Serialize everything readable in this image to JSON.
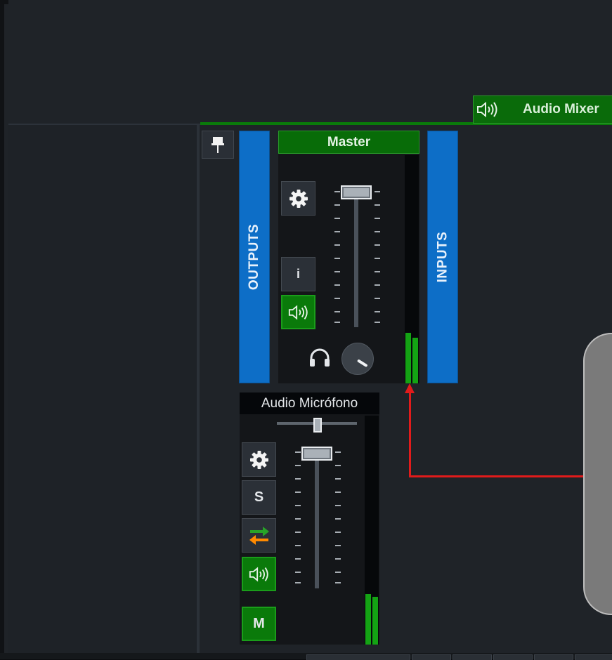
{
  "mixer_tab": {
    "label": "Audio Mixer",
    "icon": "speaker-icon"
  },
  "pin": {
    "icon": "pin-icon"
  },
  "outputs_bar": {
    "label": "OUTPUTS"
  },
  "inputs_bar": {
    "label": "INPUTS"
  },
  "master": {
    "name": "Master",
    "buttons": {
      "settings_icon": "gear-icon",
      "info_label": "i",
      "audio_icon": "speaker-icon"
    },
    "fader_level": 0.98,
    "meter_levels": [
      0.22,
      0.2
    ],
    "headphones_icon": "headphones-icon"
  },
  "mic": {
    "name": "Audio Micrófono",
    "balance": 0.5,
    "fader_level": 0.98,
    "buttons": {
      "settings_icon": "gear-icon",
      "solo_label": "S",
      "route_icon": "swap-arrows-icon",
      "audio_icon": "speaker-icon",
      "mute_label": "M"
    },
    "meter_levels": [
      0.22,
      0.21
    ]
  },
  "colors": {
    "accent_green": "#0a7a0a",
    "blue_bar": "#0d6ec7",
    "annotation_red": "#e11b1b"
  }
}
